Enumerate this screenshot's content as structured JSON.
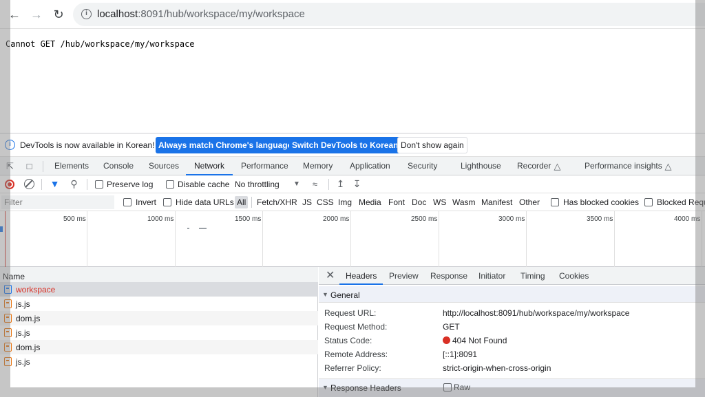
{
  "browser": {
    "url_host": "localhost",
    "url_rest": ":8091/hub/workspace/my/workspace"
  },
  "page": {
    "text": "Cannot GET /hub/workspace/my/workspace"
  },
  "infobar": {
    "message": "DevTools is now available in Korean!",
    "btn_match": "Always match Chrome's language",
    "btn_switch": "Switch DevTools to Korean",
    "btn_dont": "Don't show again"
  },
  "tabs": [
    "Elements",
    "Console",
    "Sources",
    "Network",
    "Performance",
    "Memory",
    "Application",
    "Security",
    "Lighthouse",
    "Recorder",
    "Performance insights"
  ],
  "controls": {
    "preserve_log": "Preserve log",
    "disable_cache": "Disable cache",
    "throttling": "No throttling"
  },
  "filter": {
    "placeholder": "Filter",
    "invert": "Invert",
    "hide_data_urls": "Hide data URLs",
    "types": [
      "All",
      "Fetch/XHR",
      "JS",
      "CSS",
      "Img",
      "Media",
      "Font",
      "Doc",
      "WS",
      "Wasm",
      "Manifest",
      "Other"
    ],
    "has_blocked_cookies": "Has blocked cookies",
    "blocked_requests": "Blocked Requ"
  },
  "timeline": {
    "labels": [
      "500 ms",
      "1000 ms",
      "1500 ms",
      "2000 ms",
      "2500 ms",
      "3000 ms",
      "3500 ms",
      "4000 ms"
    ]
  },
  "requests": {
    "header": "Name",
    "items": [
      "workspace",
      "js.js",
      "dom.js",
      "js.js",
      "dom.js",
      "js.js"
    ]
  },
  "detail": {
    "tabs": [
      "Headers",
      "Preview",
      "Response",
      "Initiator",
      "Timing",
      "Cookies"
    ],
    "general": "General",
    "request_url_key": "Request URL:",
    "request_url_val": "http://localhost:8091/hub/workspace/my/workspace",
    "request_method_key": "Request Method:",
    "request_method_val": "GET",
    "status_code_key": "Status Code:",
    "status_code_val": "404 Not Found",
    "remote_address_key": "Remote Address:",
    "remote_address_val": "[::1]:8091",
    "referrer_policy_key": "Referrer Policy:",
    "referrer_policy_val": "strict-origin-when-cross-origin",
    "response_headers": "Response Headers",
    "raw": "Raw"
  },
  "colors": {
    "accent": "#1a73e8",
    "error": "#d93025"
  }
}
